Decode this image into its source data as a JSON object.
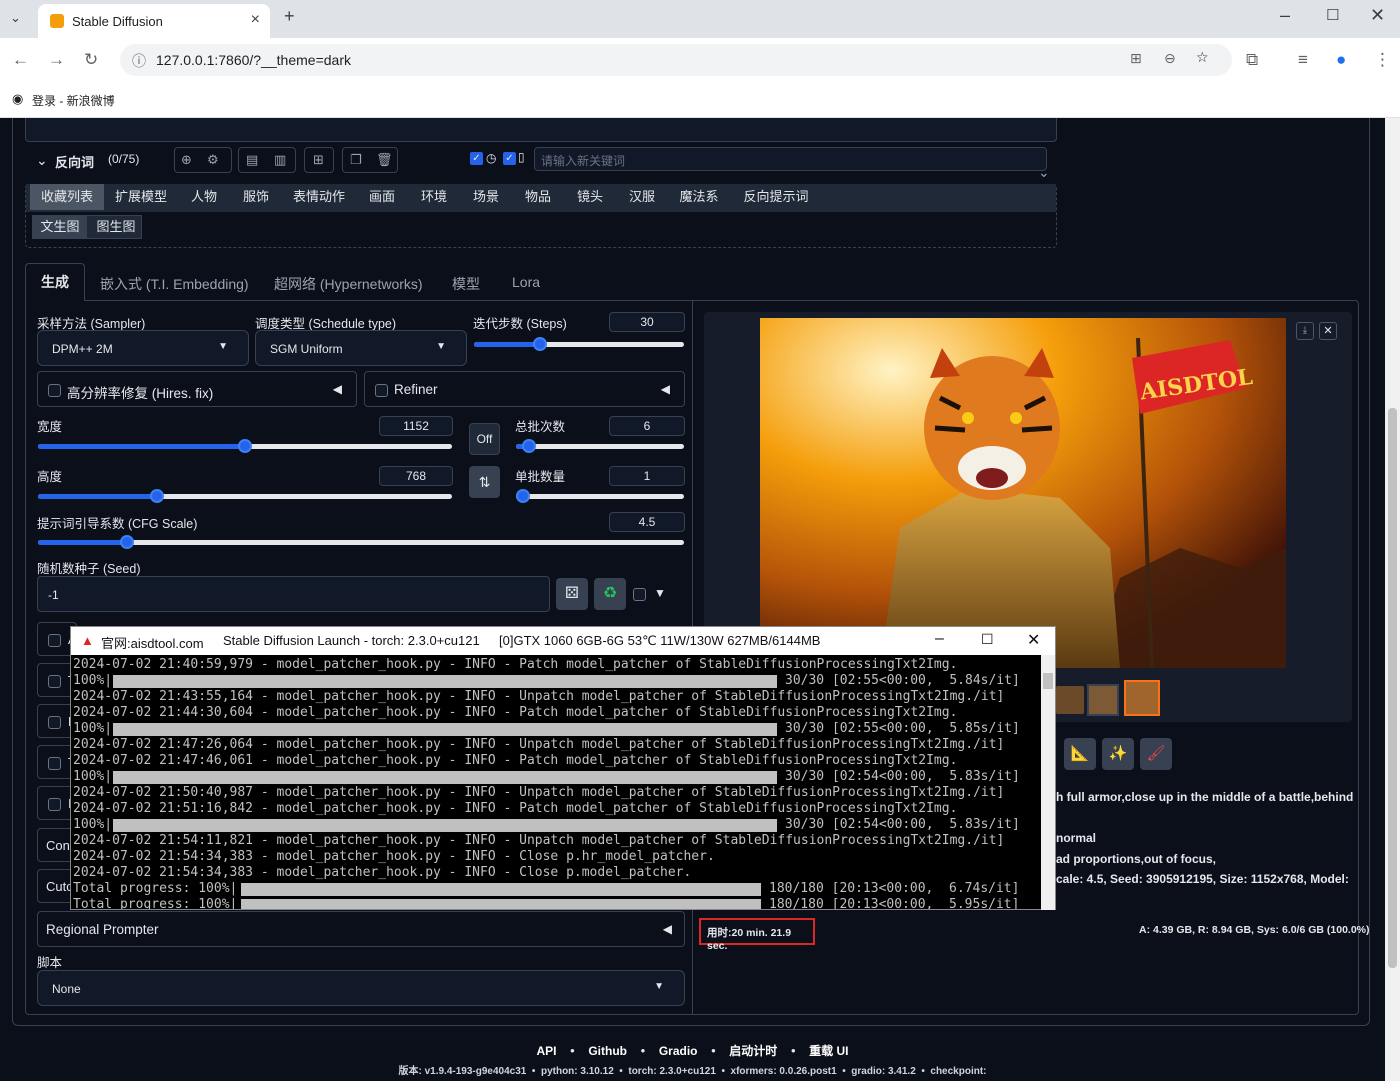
{
  "browser": {
    "tab_title": "Stable Diffusion",
    "url": "127.0.0.1:7860/?__theme=dark",
    "bookmark": "登录 - 新浪微博"
  },
  "prompt": {
    "negative_label": "反向词",
    "negative_count": "(0/75)",
    "keyword_placeholder": "请输入新关键词"
  },
  "tag_tabs": [
    "收藏列表",
    "扩展模型",
    "人物",
    "服饰",
    "表情动作",
    "画面",
    "环境",
    "场景",
    "物品",
    "镜头",
    "汉服",
    "魔法系",
    "反向提示词"
  ],
  "sub_tabs": [
    "文生图",
    "图生图"
  ],
  "main_tabs": [
    "生成",
    "嵌入式 (T.I. Embedding)",
    "超网络 (Hypernetworks)",
    "模型",
    "Lora"
  ],
  "params": {
    "sampler_label": "采样方法 (Sampler)",
    "sampler_value": "DPM++ 2M",
    "schedule_label": "调度类型 (Schedule type)",
    "schedule_value": "SGM Uniform",
    "steps_label": "迭代步数 (Steps)",
    "steps_value": "30",
    "hires_label": "高分辨率修复 (Hires. fix)",
    "refiner_label": "Refiner",
    "width_label": "宽度",
    "width_value": "1152",
    "height_label": "高度",
    "height_value": "768",
    "batch_count_label": "总批次数",
    "batch_count_value": "6",
    "batch_size_label": "单批数量",
    "batch_size_value": "1",
    "off_label": "Off",
    "swap_label": "⇅",
    "cfg_label": "提示词引导系数 (CFG Scale)",
    "cfg_value": "4.5",
    "seed_label": "随机数种子 (Seed)",
    "seed_value": "-1",
    "regional_label": "Regional Prompter",
    "script_label": "脚本",
    "script_value": "None",
    "partial_rows": [
      "A",
      "T",
      "D",
      "T",
      "I",
      "Cont",
      "Cutc"
    ]
  },
  "slider_levels": {
    "steps": 0.3,
    "width": 0.5,
    "height": 0.28,
    "batch_count": 0.04,
    "batch_size": 0.0,
    "cfg": 0.13
  },
  "output": {
    "banner_text": "AISDTOL",
    "info_line1": "h full armor,close up in the middle of a battle,behind",
    "info_line2": "normal",
    "info_line3": "ad proportions,out of focus,",
    "info_line4": "cale: 4.5, Seed: 3905912195, Size: 1152x768, Model:",
    "time_text": "用时:20 min. 21.9 sec.",
    "mem_text": "A: 4.39 GB, R: 8.94 GB, Sys: 6.0/6 GB (100.0%)"
  },
  "console": {
    "site": "官网:aisdtool.com",
    "title": "Stable Diffusion Launch - torch: 2.3.0+cu121",
    "gpu": "[0]GTX 1060 6GB-6G 53℃ 11W/130W 627MB/6144MB",
    "lines": [
      {
        "t": "2024-07-02 21:40:59,979 - model_patcher_hook.py - INFO - Patch model_patcher of StableDiffusionProcessingTxt2Img."
      },
      {
        "p": "100%|",
        "r": "30/30 [02:55<00:00,  5.84s/it]"
      },
      {
        "t": "2024-07-02 21:43:55,164 - model_patcher_hook.py - INFO - Unpatch model_patcher of StableDiffusionProcessingTxt2Img./it]"
      },
      {
        "t": "2024-07-02 21:44:30,604 - model_patcher_hook.py - INFO - Patch model_patcher of StableDiffusionProcessingTxt2Img."
      },
      {
        "p": "100%|",
        "r": "30/30 [02:55<00:00,  5.85s/it]"
      },
      {
        "t": "2024-07-02 21:47:26,064 - model_patcher_hook.py - INFO - Unpatch model_patcher of StableDiffusionProcessingTxt2Img./it]"
      },
      {
        "t": "2024-07-02 21:47:46,061 - model_patcher_hook.py - INFO - Patch model_patcher of StableDiffusionProcessingTxt2Img."
      },
      {
        "p": "100%|",
        "r": "30/30 [02:54<00:00,  5.83s/it]"
      },
      {
        "t": "2024-07-02 21:50:40,987 - model_patcher_hook.py - INFO - Unpatch model_patcher of StableDiffusionProcessingTxt2Img./it]"
      },
      {
        "t": "2024-07-02 21:51:16,842 - model_patcher_hook.py - INFO - Patch model_patcher of StableDiffusionProcessingTxt2Img."
      },
      {
        "p": "100%|",
        "r": "30/30 [02:54<00:00,  5.83s/it]"
      },
      {
        "t": "2024-07-02 21:54:11,821 - model_patcher_hook.py - INFO - Unpatch model_patcher of StableDiffusionProcessingTxt2Img./it]"
      },
      {
        "t": "2024-07-02 21:54:34,383 - model_patcher_hook.py - INFO - Close p.hr_model_patcher."
      },
      {
        "t": "2024-07-02 21:54:34,383 - model_patcher_hook.py - INFO - Close p.model_patcher."
      },
      {
        "p": "Total progress: 100%|",
        "r": "180/180 [20:13<00:00,  6.74s/it]",
        "tp": 1
      },
      {
        "p": "Total progress: 100%|",
        "r": "180/180 [20:13<00:00,  5.95s/it]",
        "tp": 1
      }
    ]
  },
  "footer": {
    "links": [
      "API",
      "Github",
      "Gradio",
      "启动计时",
      "重载 UI"
    ],
    "version": "版本: v1.9.4-193-g9e404c31  •  python: 3.10.12  •  torch: 2.3.0+cu121  •  xformers: 0.0.26.post1  •  gradio: 3.41.2  •  checkpoint:"
  }
}
